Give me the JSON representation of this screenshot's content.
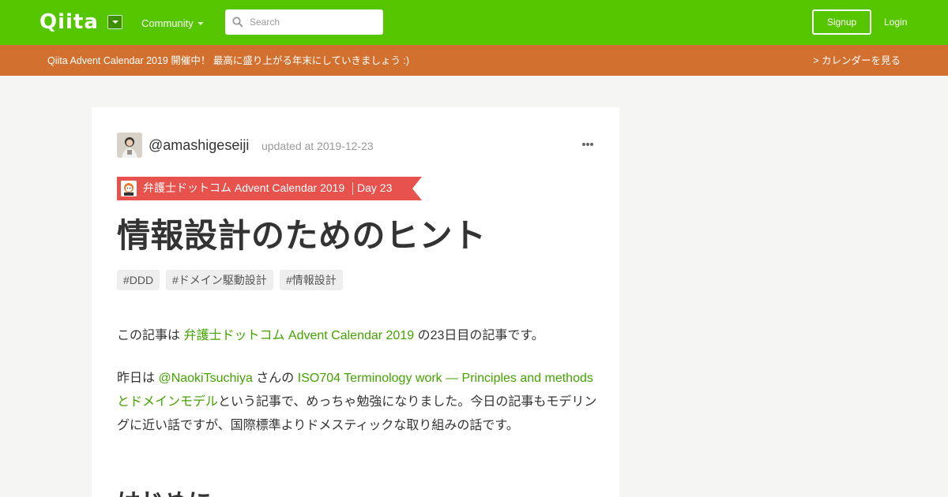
{
  "header": {
    "logo": "Qiita",
    "community_label": "Community",
    "search_placeholder": "Search",
    "signup_label": "Signup",
    "login_label": "Login"
  },
  "banner": {
    "text": "Qiita Advent Calendar 2019 開催中！ 最高に盛り上がる年末にしていきましょう :)",
    "link_label": "> カレンダーを見る"
  },
  "article": {
    "author": "@amashigeseiji",
    "updated": "updated at 2019-12-23",
    "calendar": {
      "name": "弁護士ドットコム Advent Calendar 2019",
      "day": "Day 23"
    },
    "title": "情報設計のためのヒント",
    "tags": [
      "#DDD",
      "#ドメイン駆動設計",
      "#情報設計"
    ],
    "intro": {
      "prefix": "この記事は ",
      "link": "弁護士ドットコム Advent Calendar 2019",
      "suffix": " の23日目の記事です。"
    },
    "yesterday": {
      "prefix": "昨日は ",
      "user_link": "@NaokiTsuchiya",
      "mid": " さんの ",
      "article_link": "ISO704 Terminology work — Principles and methodsとドメインモデル",
      "suffix": "という記事で、めっちゃ勉強になりました。今日の記事もモデリングに近い話ですが、国際標準よりドメスティックな取り組みの話です。"
    },
    "section_heading": "はじめに"
  },
  "colors": {
    "brand_green": "#55c500",
    "banner_orange": "#d2712f",
    "ribbon_red": "#e8524d",
    "link_green": "#44a300"
  }
}
